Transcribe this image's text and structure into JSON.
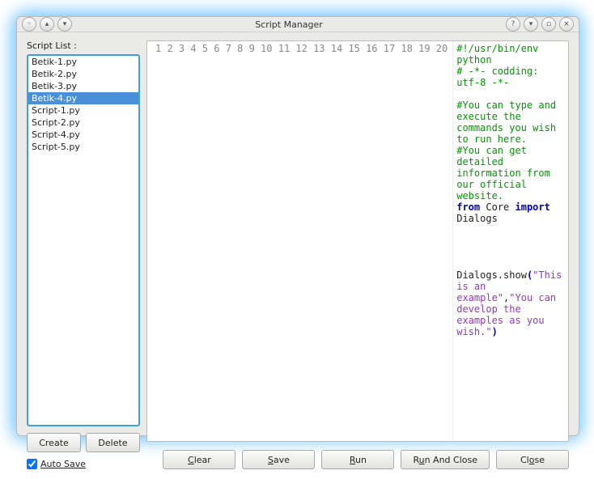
{
  "title": "Script Manager",
  "sidebar": {
    "label": "Script List :",
    "items": [
      "Betik-1.py",
      "Betik-2.py",
      "Betik-3.py",
      "Betik-4.py",
      "Script-1.py",
      "Script-2.py",
      "Script-4.py",
      "Script-5.py"
    ],
    "selected_index": 3,
    "create": "Create",
    "delete": "Delete",
    "autosave": "Auto Save",
    "autosave_checked": true
  },
  "editor": {
    "line_count": 20,
    "lines": [
      {
        "n": 1,
        "segs": [
          {
            "t": "#!/usr/bin/env python",
            "cls": "c-green"
          }
        ]
      },
      {
        "n": 2,
        "segs": [
          {
            "t": "# -*- codding: utf-8 -*-",
            "cls": "c-green"
          }
        ]
      },
      {
        "n": 3,
        "segs": []
      },
      {
        "n": 4,
        "segs": [
          {
            "t": "#You can type and execute the commands you wish to run here.",
            "cls": "c-green"
          }
        ]
      },
      {
        "n": 5,
        "segs": [
          {
            "t": "#You can get detailed information from our official website.",
            "cls": "c-green"
          }
        ]
      },
      {
        "n": 6,
        "segs": [
          {
            "t": "from",
            "cls": "c-blue"
          },
          {
            "t": " Core "
          },
          {
            "t": "import",
            "cls": "c-blue"
          },
          {
            "t": " Dialogs"
          }
        ]
      },
      {
        "n": 7,
        "segs": []
      },
      {
        "n": 8,
        "segs": []
      },
      {
        "n": 9,
        "segs": []
      },
      {
        "n": 10,
        "segs": []
      },
      {
        "n": 11,
        "segs": [
          {
            "t": "Dialogs.show"
          },
          {
            "t": "(",
            "cls": "c-blue"
          },
          {
            "t": "\"This is an example\"",
            "cls": "c-purple"
          },
          {
            "t": ","
          },
          {
            "t": "\"You can develop the examples as you wish.\"",
            "cls": "c-purple"
          },
          {
            "t": ")",
            "cls": "c-blue"
          }
        ]
      }
    ]
  },
  "buttons": {
    "clear": "Clear",
    "save": "Save",
    "run": "Run",
    "runclose": "Run And Close",
    "close": "Close"
  }
}
